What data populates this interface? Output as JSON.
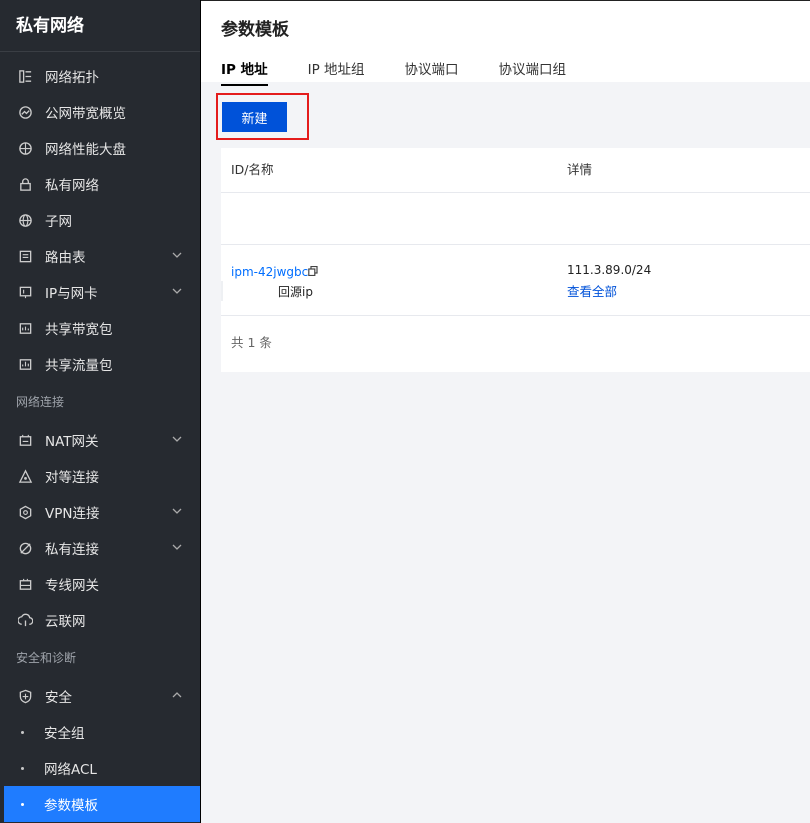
{
  "sidebar": {
    "title": "私有网络",
    "items_top": [
      {
        "label": "网络拓扑",
        "icon": "topology-icon"
      },
      {
        "label": "公网带宽概览",
        "icon": "bandwidth-icon"
      },
      {
        "label": "网络性能大盘",
        "icon": "performance-icon"
      },
      {
        "label": "私有网络",
        "icon": "lock-icon"
      },
      {
        "label": "子网",
        "icon": "globe-icon"
      },
      {
        "label": "路由表",
        "icon": "route-table-icon",
        "expandable": true
      },
      {
        "label": "IP与网卡",
        "icon": "nic-icon",
        "expandable": true
      },
      {
        "label": "共享带宽包",
        "icon": "shared-bandwidth-icon"
      },
      {
        "label": "共享流量包",
        "icon": "shared-traffic-icon"
      }
    ],
    "section_connect": "网络连接",
    "items_connect": [
      {
        "label": "NAT网关",
        "icon": "nat-gateway-icon",
        "expandable": true
      },
      {
        "label": "对等连接",
        "icon": "peering-icon"
      },
      {
        "label": "VPN连接",
        "icon": "vpn-icon",
        "expandable": true
      },
      {
        "label": "私有连接",
        "icon": "private-link-icon",
        "expandable": true
      },
      {
        "label": "专线网关",
        "icon": "dc-gateway-icon"
      },
      {
        "label": "云联网",
        "icon": "ccn-icon"
      }
    ],
    "section_security": "安全和诊断",
    "security": {
      "label": "安全",
      "icon": "shield-icon"
    },
    "security_sub": [
      "安全组",
      "网络ACL",
      "参数模板"
    ],
    "active_sub": "参数模板"
  },
  "main": {
    "title": "参数模板",
    "tabs": [
      "IP 地址",
      "IP 地址组",
      "协议端口",
      "协议端口组"
    ],
    "active_tab": "IP 地址",
    "new_button": "新建",
    "table": {
      "columns": [
        "ID/名称",
        "详情"
      ],
      "rows": [
        {
          "id": "ipm-42jwgbc",
          "name": "回源ip",
          "detail": "111.3.89.0/24",
          "detail_link": "查看全部"
        }
      ],
      "total": "共 1 条"
    }
  },
  "colors": {
    "sidebar_bg": "#262a30",
    "accent": "#1f7cff",
    "primary_button": "#0052d9",
    "highlight": "#e41c1c"
  }
}
